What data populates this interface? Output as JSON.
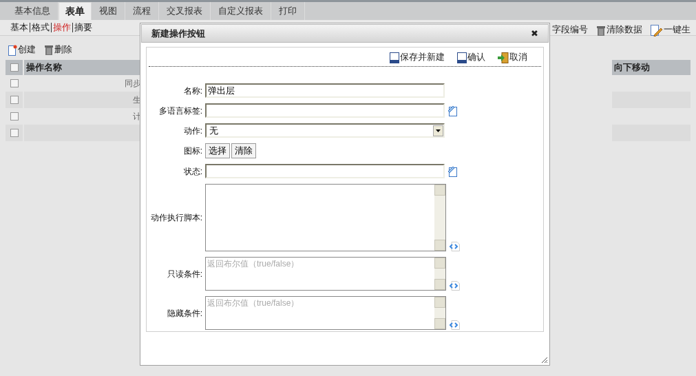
{
  "tabs": [
    {
      "label": "基本信息",
      "selected": false
    },
    {
      "label": "表单",
      "selected": true
    },
    {
      "label": "视图",
      "selected": false
    },
    {
      "label": "流程",
      "selected": false
    },
    {
      "label": "交叉报表",
      "selected": false
    },
    {
      "label": "自定义报表",
      "selected": false
    },
    {
      "label": "打印",
      "selected": false
    }
  ],
  "subtabs": [
    {
      "label": "基本",
      "selected": false
    },
    {
      "label": "格式",
      "selected": false
    },
    {
      "label": "操作",
      "selected": true
    },
    {
      "label": "摘要",
      "selected": false
    }
  ],
  "toolbar": [
    {
      "label": "创建",
      "kind": "create"
    },
    {
      "label": "删除",
      "kind": "delete"
    }
  ],
  "right_toolbar": [
    {
      "label": "字段编号",
      "kind": "plain"
    },
    {
      "label": "清除数据",
      "kind": "delete"
    },
    {
      "label": "一键生",
      "kind": "generate"
    }
  ],
  "table": {
    "all_checked": false,
    "columns": [
      "操作名称",
      "向下移动"
    ],
    "rows": [
      {
        "checked": false,
        "name": "同步"
      },
      {
        "checked": false,
        "name": "生"
      },
      {
        "checked": false,
        "name": "计"
      },
      {
        "checked": false
      }
    ]
  },
  "dialog": {
    "title": "新建操作按钮",
    "close": "✖",
    "actions": [
      {
        "label": "保存并新建",
        "kind": "save"
      },
      {
        "label": "确认",
        "kind": "save"
      },
      {
        "label": "取消",
        "kind": "exit"
      }
    ],
    "fields": [
      {
        "kind": "text",
        "label": "名称:",
        "value": "弹出层"
      },
      {
        "kind": "text",
        "label": "多语言标签:",
        "edit_button": true
      },
      {
        "kind": "select",
        "label": "动作:",
        "value": "无"
      },
      {
        "kind": "buttons",
        "label": "图标:",
        "buttons": [
          "选择",
          "清除"
        ]
      },
      {
        "kind": "text",
        "label": "状态:",
        "edit_button": true
      },
      {
        "kind": "textarea",
        "label": "动作执行脚本:",
        "tall": true,
        "code_button": true
      },
      {
        "kind": "textarea",
        "label": "只读条件:",
        "placeholder": "返回布尔值（true/false）",
        "tall": false,
        "code_button": true
      },
      {
        "kind": "textarea",
        "label": "隐藏条件:",
        "placeholder": "返回布尔值（true/false）",
        "tall": false,
        "code_button": true
      }
    ]
  }
}
